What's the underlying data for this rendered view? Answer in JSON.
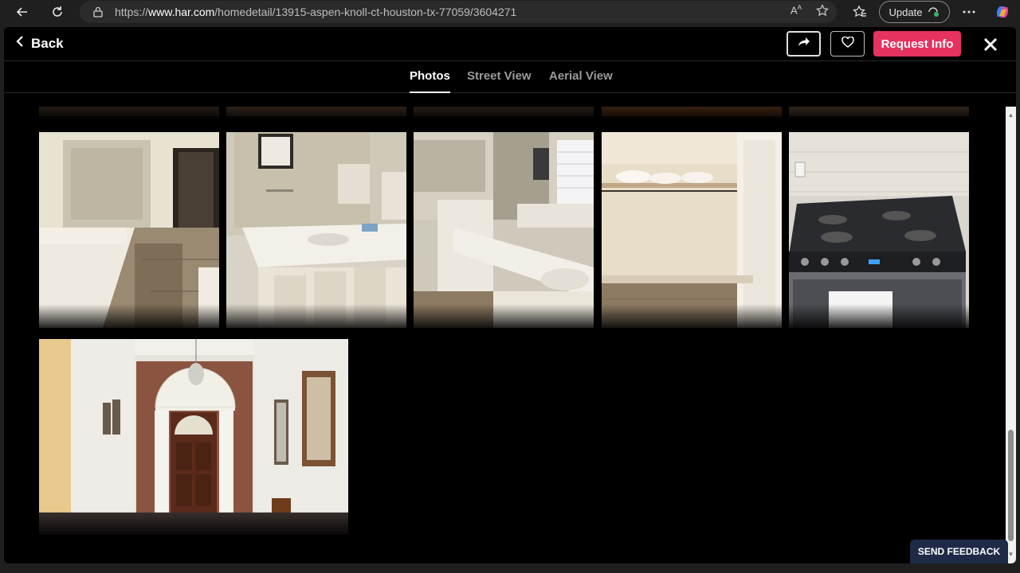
{
  "browser": {
    "url_prefix": "https://",
    "url_host": "www.har.com",
    "url_path": "/homedetail/13915-aspen-knoll-ct-houston-tx-77059/3604271",
    "update_label": "Update"
  },
  "header": {
    "back_label": "Back",
    "request_label": "Request Info"
  },
  "tabs": [
    {
      "label": "Photos",
      "active": true
    },
    {
      "label": "Street View",
      "active": false
    },
    {
      "label": "Aerial View",
      "active": false
    }
  ],
  "photos": [
    {
      "name": "photo-master-bath-vanity"
    },
    {
      "name": "photo-bath-sink"
    },
    {
      "name": "photo-bath-tub-vanity"
    },
    {
      "name": "photo-walk-in-closet"
    },
    {
      "name": "photo-gas-range"
    },
    {
      "name": "photo-front-entry"
    }
  ],
  "feedback_label": "SEND FEEDBACK",
  "colors": {
    "accent": "#e6325f",
    "background": "#000000",
    "feedback_bg": "#1e2a47"
  }
}
